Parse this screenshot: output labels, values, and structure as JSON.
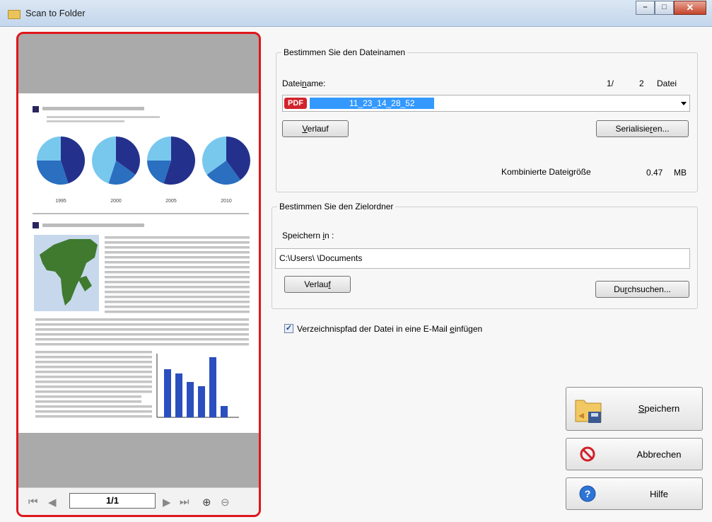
{
  "window": {
    "title": "Scan to Folder",
    "min_glyph": "–",
    "max_glyph": "□",
    "close_glyph": "✕"
  },
  "preview": {
    "page_value": "1/1",
    "chart_years": [
      "1995",
      "2000",
      "2005",
      "2010"
    ],
    "nav_icons": [
      "first-page-icon",
      "prev-page-icon",
      "next-page-icon",
      "last-page-icon",
      "zoom-in-icon",
      "zoom-out-icon"
    ]
  },
  "filename_group": {
    "title": "Bestimmen Sie den Dateinamen",
    "label_pre": "Datei",
    "label_ul": "n",
    "label_post": "ame:",
    "counter_current": "1/",
    "counter_total": "2",
    "counter_unit": "Datei",
    "file_icon_text": "PDF",
    "filename_value": "11_23_14_28_52",
    "history_pre": "",
    "history_ul": "V",
    "history_post": "erlauf",
    "serialize_pre": "Serialisie",
    "serialize_ul": "r",
    "serialize_post": "en...",
    "size_label": "Kombinierte Dateigröße",
    "size_value": "0.47",
    "size_unit": "MB"
  },
  "folder_group": {
    "title": "Bestimmen Sie den Zielordner",
    "label_pre": "Speichern ",
    "label_ul": "i",
    "label_post": "n :",
    "path_value": "C:\\Users\\      \\Documents",
    "history_pre": "Verlau",
    "history_ul": "f",
    "history_post": "",
    "browse_pre": "Du",
    "browse_ul": "r",
    "browse_post": "chsuchen..."
  },
  "email_option": {
    "checked": true,
    "label_pre": "Verzeichnispfad der Datei in eine E-Mail ",
    "label_ul": "e",
    "label_post": "infügen"
  },
  "actions": {
    "save_pre": "",
    "save_ul": "S",
    "save_post": "peichern",
    "cancel": "Abbrechen",
    "help": "Hilfe"
  },
  "colors": {
    "highlight": "#e0161c",
    "selection": "#3399ff",
    "pdf_badge": "#d2232a",
    "chart_dark": "#24318c",
    "chart_mid": "#2a6fc0",
    "chart_light": "#78c8ee"
  }
}
